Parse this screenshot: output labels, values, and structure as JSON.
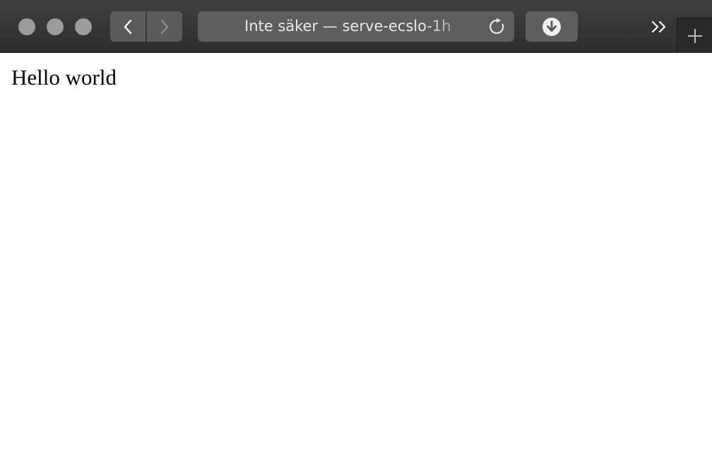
{
  "browser": {
    "address_text": "Inte säker — serve-ecslo-1h",
    "icons": {
      "back": "chevron-left-icon",
      "forward": "chevron-right-icon",
      "reload": "reload-icon",
      "download": "download-icon",
      "overflow": "double-chevron-right-icon",
      "new_tab": "plus-icon"
    },
    "colors": {
      "toolbar": "#383838",
      "control": "#5e5e5e",
      "traffic_light": "#9c9c9c"
    }
  },
  "page": {
    "text": "Hello world"
  }
}
